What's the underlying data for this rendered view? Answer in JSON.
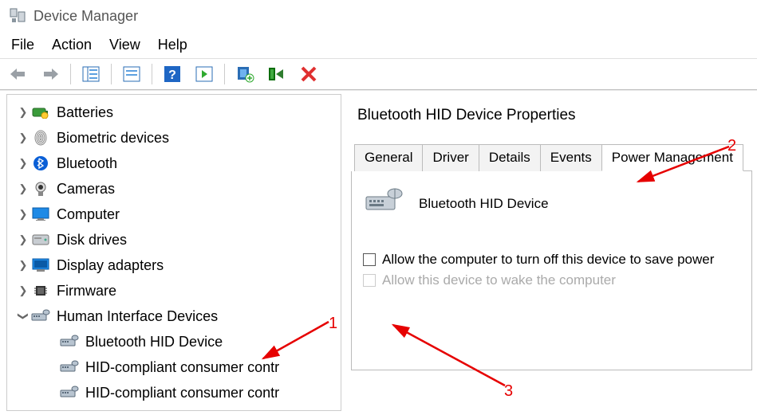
{
  "window": {
    "title": "Device Manager"
  },
  "menus": {
    "file": "File",
    "action": "Action",
    "view": "View",
    "help": "Help"
  },
  "tree": {
    "items": [
      {
        "label": "Batteries",
        "icon": "battery"
      },
      {
        "label": "Biometric devices",
        "icon": "fingerprint"
      },
      {
        "label": "Bluetooth",
        "icon": "bluetooth"
      },
      {
        "label": "Cameras",
        "icon": "camera"
      },
      {
        "label": "Computer",
        "icon": "monitor"
      },
      {
        "label": "Disk drives",
        "icon": "disk"
      },
      {
        "label": "Display adapters",
        "icon": "display-adapter"
      },
      {
        "label": "Firmware",
        "icon": "chip"
      }
    ],
    "expanded": {
      "label": "Human Interface Devices",
      "icon": "hid",
      "children": [
        "Bluetooth HID Device",
        "HID-compliant consumer contr",
        "HID-compliant consumer contr"
      ]
    }
  },
  "props": {
    "title": "Bluetooth HID Device Properties",
    "tabs": {
      "general": "General",
      "driver": "Driver",
      "details": "Details",
      "events": "Events",
      "power": "Power Management"
    },
    "device_name": "Bluetooth HID Device",
    "chk1": "Allow the computer to turn off this device to save power",
    "chk2": "Allow this device to wake the computer"
  },
  "annotations": {
    "n1": "1",
    "n2": "2",
    "n3": "3"
  }
}
